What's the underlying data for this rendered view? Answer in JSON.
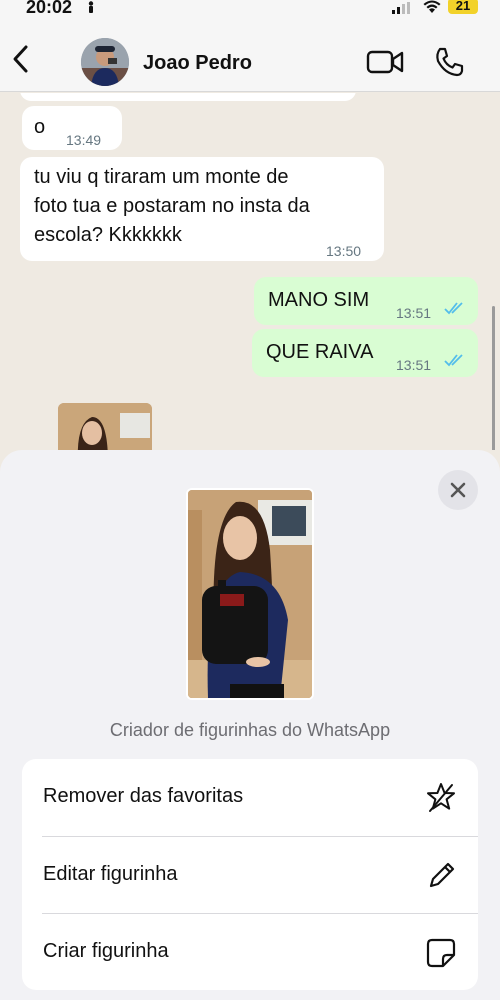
{
  "status_bar": {
    "time": "20:02",
    "battery": "21"
  },
  "header": {
    "contact_name": "Joao Pedro"
  },
  "messages": [
    {
      "direction": "in",
      "text": "o",
      "time": "13:49"
    },
    {
      "direction": "in",
      "text": "tu viu q tiraram um monte de\nfoto tua e postaram no insta da\nescola? Kkkkkkk",
      "time": "13:50"
    },
    {
      "direction": "out",
      "text": "MANO SIM",
      "time": "13:51",
      "status": "read"
    },
    {
      "direction": "out",
      "text": "QUE RAIVA",
      "time": "13:51",
      "status": "read"
    }
  ],
  "sheet": {
    "caption": "Criador de figurinhas do WhatsApp",
    "actions": [
      {
        "label": "Remover das favoritas",
        "icon": "star-remove-icon"
      },
      {
        "label": "Editar figurinha",
        "icon": "pencil-icon"
      },
      {
        "label": "Criar figurinha",
        "icon": "sticker-icon"
      }
    ]
  },
  "colors": {
    "outgoing_bubble": "#d9fdd3",
    "incoming_bubble": "#ffffff",
    "read_ticks": "#53bdeb",
    "chat_background": "#efeae2"
  }
}
